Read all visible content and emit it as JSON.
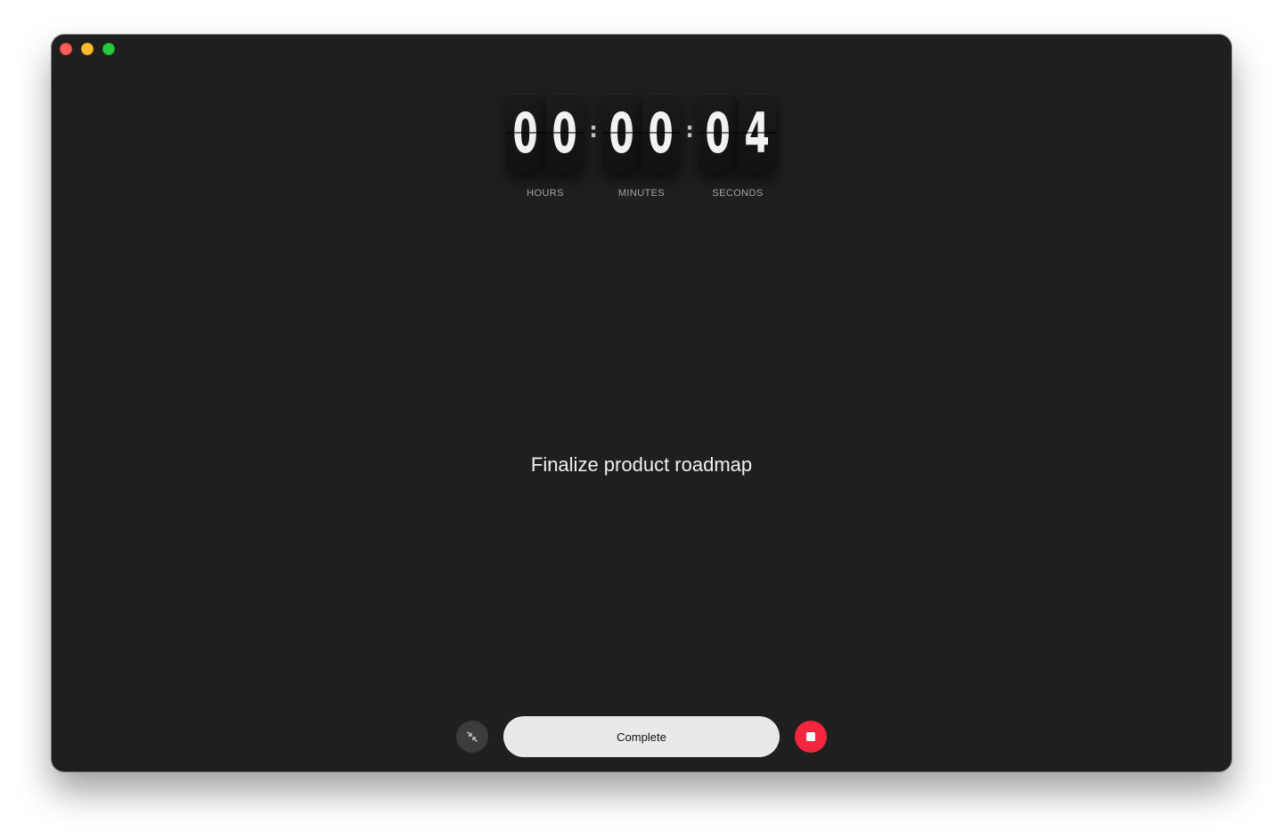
{
  "window": {
    "controls": [
      "close",
      "minimize",
      "zoom"
    ]
  },
  "timer": {
    "hours": [
      "0",
      "0"
    ],
    "minutes": [
      "0",
      "0"
    ],
    "seconds": [
      "0",
      "4"
    ],
    "separator": ":",
    "labels": {
      "hours": "HOURS",
      "minutes": "MINUTES",
      "seconds": "SECONDS"
    }
  },
  "task": {
    "title": "Finalize product roadmap"
  },
  "controls": {
    "collapse_icon": "collapse-arrows-icon",
    "complete_label": "Complete",
    "stop_icon": "stop-icon"
  },
  "colors": {
    "background": "#1f1f1f",
    "stop": "#f3263f",
    "complete_button": "#e9e9e9",
    "close": "#fe5f57",
    "minimize": "#febc2e",
    "zoom": "#28c840"
  }
}
